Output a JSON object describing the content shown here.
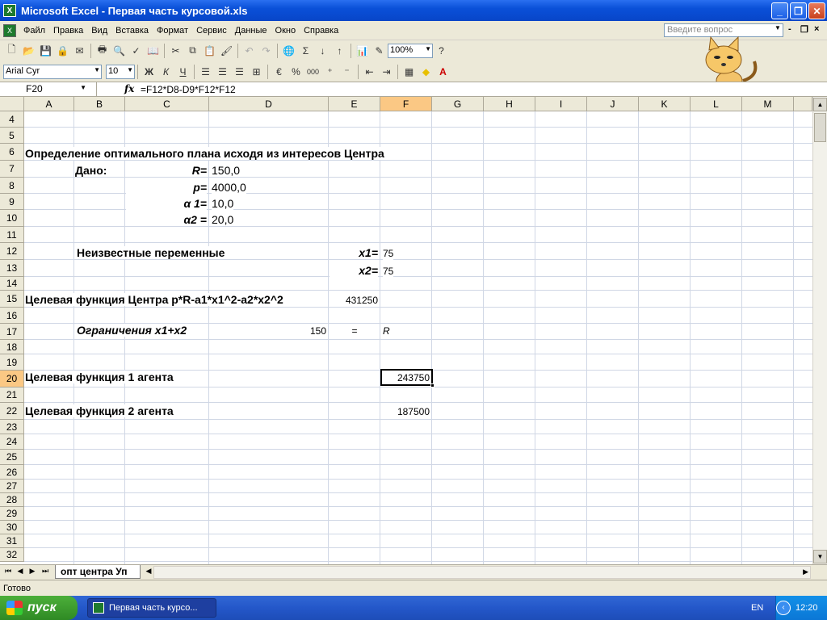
{
  "window": {
    "title": "Microsoft Excel - Первая часть курсовой.xls",
    "icon_text": "X"
  },
  "menu": {
    "items": [
      "Файл",
      "Правка",
      "Вид",
      "Вставка",
      "Формат",
      "Сервис",
      "Данные",
      "Окно",
      "Справка"
    ],
    "ask_placeholder": "Введите вопрос"
  },
  "toolbar": {
    "zoom": "100%",
    "font_name": "Arial Cyr",
    "font_size": "10",
    "bold": "Ж",
    "italic": "К",
    "underline": "Ч",
    "percent": "%",
    "thousands": "000",
    "sum": "Σ"
  },
  "formula_bar": {
    "cell_ref": "F20",
    "fx": "fx",
    "formula": "=F12*D8-D9*F12*F12"
  },
  "columns": [
    "A",
    "B",
    "C",
    "D",
    "E",
    "F",
    "G",
    "H",
    "I",
    "J",
    "K",
    "L",
    "M"
  ],
  "rows": [
    "4",
    "5",
    "6",
    "7",
    "8",
    "9",
    "10",
    "11",
    "12",
    "13",
    "14",
    "15",
    "16",
    "17",
    "18",
    "19",
    "20",
    "21",
    "22",
    "23",
    "24",
    "25",
    "26",
    "27",
    "28",
    "29",
    "30",
    "31",
    "32"
  ],
  "cells": {
    "A6": "Определение оптимального плана исходя из интересов Центра",
    "B7": "Дано:",
    "C7": "R=",
    "D7": "150,0",
    "C8": "p=",
    "D8": "4000,0",
    "C9": "α 1=",
    "D9": "10,0",
    "C10": "α2 =",
    "D10": "20,0",
    "B12": "Неизвестные переменные",
    "E12": "x1=",
    "F12": "75",
    "E13": "x2=",
    "F13": "75",
    "A15": "Целевая функция Центра p*R-a1*x1^2-a2*x2^2",
    "E15": "431250",
    "B17": "Ограничения x1+x2",
    "D17": "150",
    "E17": "=",
    "F17": "R",
    "A20": "Целевая функция 1 агента",
    "F20": "243750",
    "A22": "Целевая функция 2 агента",
    "F22": "187500"
  },
  "sheet_tab": "опт центра Уп",
  "status": "Готово",
  "taskbar": {
    "start": "пуск",
    "task": "Первая часть курсо...",
    "lang": "EN",
    "clock": "12:20"
  },
  "selected": {
    "column": "F",
    "row": "20"
  }
}
